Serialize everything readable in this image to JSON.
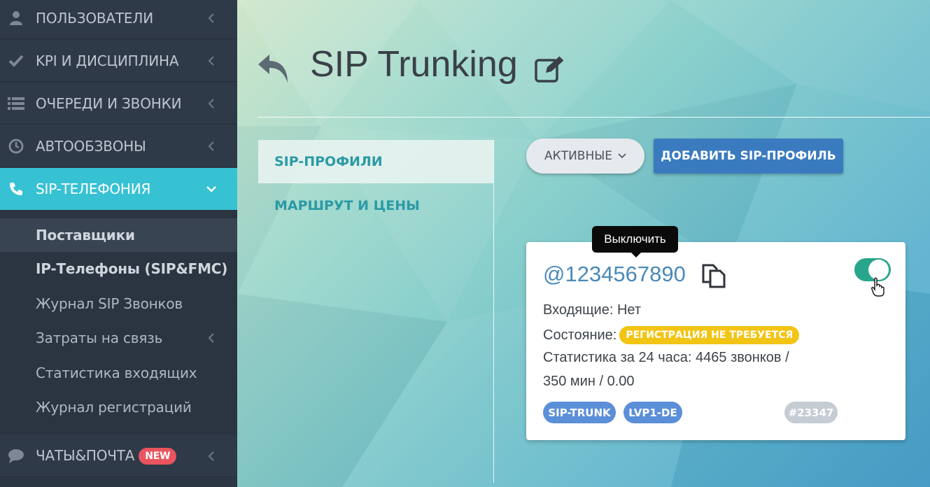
{
  "sidebar": {
    "items": [
      {
        "label": "ПОЛЬЗОВАТЕЛИ",
        "icon": "user-icon"
      },
      {
        "label": "KPI И ДИСЦИПЛИНА",
        "icon": "check-icon"
      },
      {
        "label": "ОЧЕРЕДИ И ЗВОНКИ",
        "icon": "list-icon"
      },
      {
        "label": "АВТООБЗВОНЫ",
        "icon": "clock-icon"
      },
      {
        "label": "SIP-ТЕЛЕФОНИЯ",
        "icon": "phone-icon",
        "active": true
      },
      {
        "label": "ЧАТЫ&ПОЧТА",
        "icon": "chat-icon",
        "badge": "NEW"
      }
    ],
    "submenu": [
      {
        "label": "Поставщики",
        "selected": true
      },
      {
        "label": "IP-Телефоны (SIP&FMC)"
      },
      {
        "label": "Журнал SIP Звонков"
      },
      {
        "label": "Затраты на связь"
      },
      {
        "label": "Статистика входящих"
      },
      {
        "label": "Журнал регистраций"
      }
    ],
    "accent_color": "#37c2d4"
  },
  "header": {
    "title": "SIP Trunking"
  },
  "tabs": [
    {
      "label": "SIP-ПРОФИЛИ",
      "active": true
    },
    {
      "label": "МАРШРУТ И ЦЕНЫ"
    }
  ],
  "toolbar": {
    "filter_label": "АКТИВНЫЕ",
    "add_label": "ДОБАВИТЬ SIP-ПРОФИЛЬ"
  },
  "card": {
    "number": "@1234567890",
    "incoming": "Входящие: Нет",
    "state_label": "Состояние:",
    "state_badge": "РЕГИСТРАЦИЯ НЕ ТРЕБУЕТСЯ",
    "stats_line1": "Статистика за 24 часа: 4465 звонков /",
    "stats_line2": "350 мин / 0.00",
    "tags": [
      "SIP-TRUNK",
      "LVP1-DE"
    ],
    "id_tag": "#23347",
    "toggle_on": true
  },
  "tooltip": {
    "text": "Выключить"
  },
  "colors": {
    "toggle_on": "#28a58a",
    "badge_yellow": "#f2c413",
    "tag_blue": "#5b8fd8",
    "button_blue": "#3a7bbf",
    "new_badge": "#e9545f"
  }
}
